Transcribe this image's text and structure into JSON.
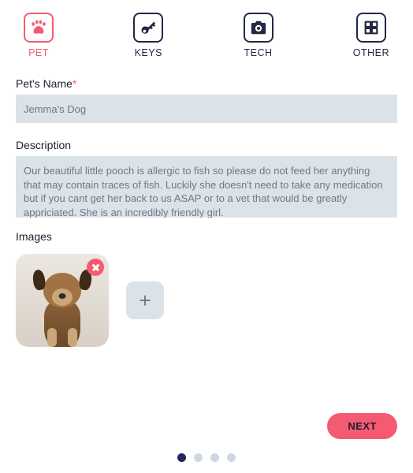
{
  "tabs": [
    {
      "id": "pet",
      "label": "PET",
      "active": true
    },
    {
      "id": "keys",
      "label": "KEYS",
      "active": false
    },
    {
      "id": "tech",
      "label": "TECH",
      "active": false
    },
    {
      "id": "other",
      "label": "OTHER",
      "active": false
    }
  ],
  "form": {
    "name_label": "Pet's Name",
    "name_required_marker": "*",
    "name_value": "Jemma's Dog",
    "desc_label": "Description",
    "desc_value": "Our beautiful little pooch is allergic to fish so please do not feed her anything that may contain traces of fish. Luckily she doesn't need to take any medication but if you cant get her back to us ASAP or to a vet that would be greatly appriciated. She is an incredibly friendly girl.",
    "images_label": "Images",
    "add_symbol": "+"
  },
  "footer": {
    "next_label": "NEXT",
    "dot_active_index": 0,
    "dot_count": 4
  }
}
